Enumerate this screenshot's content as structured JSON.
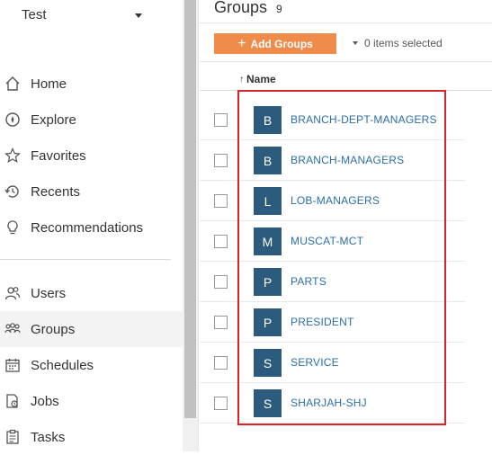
{
  "sidebar": {
    "site_name": "Test",
    "items": [
      {
        "label": "Home",
        "icon": "home-icon"
      },
      {
        "label": "Explore",
        "icon": "compass-icon"
      },
      {
        "label": "Favorites",
        "icon": "star-icon"
      },
      {
        "label": "Recents",
        "icon": "history-icon"
      },
      {
        "label": "Recommendations",
        "icon": "lightbulb-icon"
      },
      {
        "label": "Users",
        "icon": "users-icon"
      },
      {
        "label": "Groups",
        "icon": "groups-icon"
      },
      {
        "label": "Schedules",
        "icon": "calendar-icon"
      },
      {
        "label": "Jobs",
        "icon": "jobs-icon"
      },
      {
        "label": "Tasks",
        "icon": "tasks-icon"
      }
    ],
    "active_item": "Groups"
  },
  "header": {
    "title": "Groups",
    "count": "9"
  },
  "toolbar": {
    "add_label": "Add Groups",
    "selection_label": "0 items selected"
  },
  "table": {
    "column_name": "Name",
    "sort_indicator": "↑",
    "rows": [
      {
        "initial": "B",
        "name": "BRANCH-DEPT-MANAGERS"
      },
      {
        "initial": "B",
        "name": "BRANCH-MANAGERS"
      },
      {
        "initial": "L",
        "name": "LOB-MANAGERS"
      },
      {
        "initial": "M",
        "name": "MUSCAT-MCT"
      },
      {
        "initial": "P",
        "name": "PARTS"
      },
      {
        "initial": "P",
        "name": "PRESIDENT"
      },
      {
        "initial": "S",
        "name": "SERVICE"
      },
      {
        "initial": "S",
        "name": "SHARJAH-SHJ"
      }
    ]
  },
  "colors": {
    "accent_button": "#ef8b4b",
    "avatar": "#2d5b7d",
    "link": "#2b6fa6",
    "highlight": "#d9242b"
  }
}
